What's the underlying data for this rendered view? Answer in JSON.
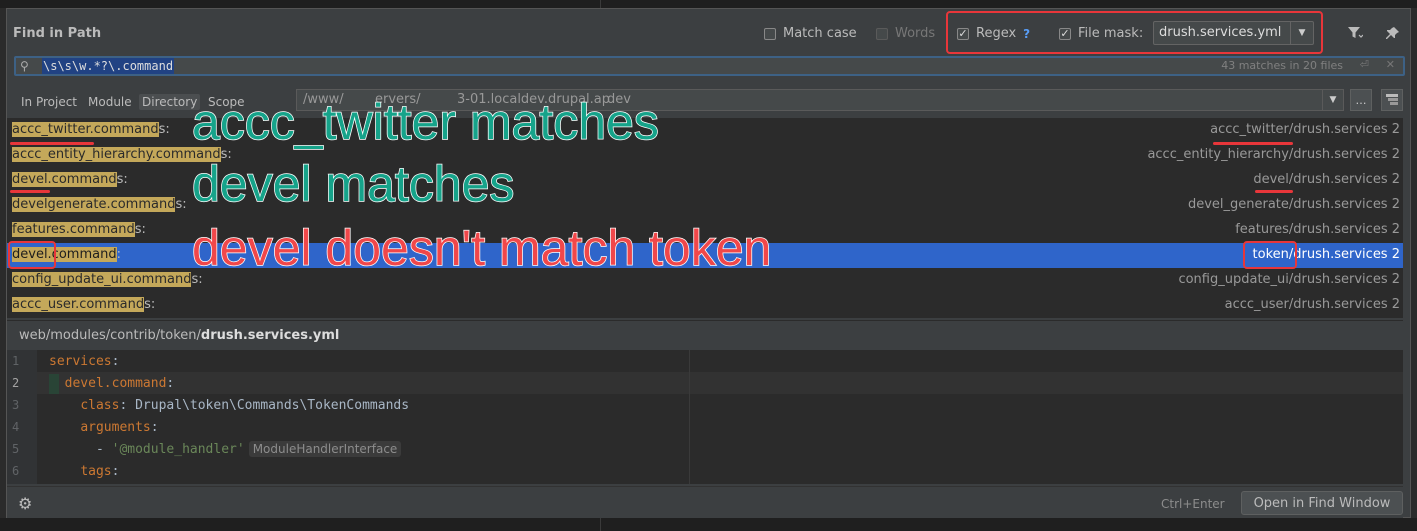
{
  "title": "Find in Path",
  "options": {
    "match_case": {
      "label": "Match case",
      "checked": false
    },
    "words": {
      "label": "Words",
      "checked": false,
      "disabled": true
    },
    "regex": {
      "label": "Regex",
      "checked": true,
      "help": "?"
    },
    "file_mask": {
      "label": "File mask:",
      "checked": true,
      "value": "drush.services.yml"
    }
  },
  "search": {
    "query": "\\s\\s\\w.*?\\.command",
    "match_count": "43 matches in 20 files"
  },
  "scope": {
    "in_project": "In Project",
    "module": "Module",
    "directory": "Directory",
    "scope": "Scope",
    "selected": "Directory",
    "path_fragments": [
      "/www/",
      "ervers/",
      "3-01.localdev.drupal.ap",
      "dev"
    ]
  },
  "results": [
    {
      "match": "accc_twitter.command",
      "suffix": "s:",
      "file": "accc_twitter/drush.services 2"
    },
    {
      "match": "accc_entity_hierarchy.command",
      "suffix": "s:",
      "file": "accc_entity_hierarchy/drush.services 2"
    },
    {
      "match": "devel.command",
      "suffix": "s:",
      "file": "devel/drush.services 2"
    },
    {
      "match": "develgenerate.command",
      "suffix": "s:",
      "file": "devel_generate/drush.services 2"
    },
    {
      "match": "features.command",
      "suffix": "s:",
      "file": "features/drush.services 2"
    },
    {
      "match": "devel.command",
      "suffix": ":",
      "file": "token/drush.services 2",
      "selected": true
    },
    {
      "match": "config_update_ui.command",
      "suffix": "s:",
      "file": "config_update_ui/drush.services 2"
    },
    {
      "match": "accc_user.command",
      "suffix": "s:",
      "file": "accc_user/drush.services 2"
    }
  ],
  "preview": {
    "path_prefix": "web/modules/contrib/token/",
    "path_file": "drush.services.yml",
    "lines": [
      {
        "n": "1",
        "key": "services",
        "colon": ":"
      },
      {
        "n": "2",
        "key": "devel.command",
        "colon": ":"
      },
      {
        "n": "3",
        "key": "class",
        "colon": ": ",
        "value": "Drupal\\token\\Commands\\TokenCommands"
      },
      {
        "n": "4",
        "key": "arguments",
        "colon": ":"
      },
      {
        "n": "5",
        "dash": "- ",
        "string": "'@module_handler'",
        "hint": "ModuleHandlerInterface"
      },
      {
        "n": "6",
        "key": "tags",
        "colon": ":"
      }
    ]
  },
  "footer": {
    "shortcut": "Ctrl+Enter",
    "open_button": "Open in Find Window"
  },
  "annotations": {
    "line1": "accc_twitter matches",
    "line2": "devel matches",
    "line3": "devel doesn't match token"
  }
}
